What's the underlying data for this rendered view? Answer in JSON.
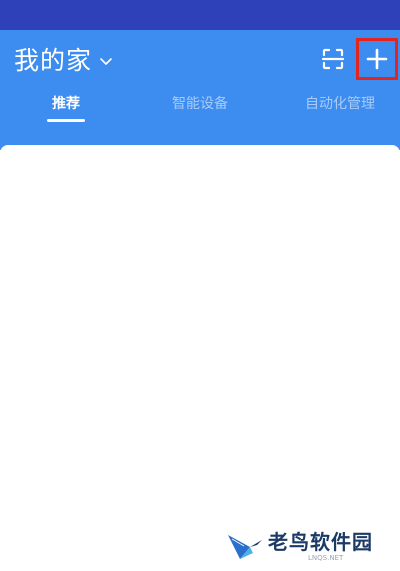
{
  "header": {
    "home_title": "我的家",
    "chevron_icon": "chevron-down-icon",
    "scan_icon": "scan-icon",
    "add_icon": "plus-icon",
    "background_color": "#3d8cf0",
    "highlight_color": "#e3241f"
  },
  "tabs": [
    {
      "label": "推荐",
      "active": true
    },
    {
      "label": "智能设备",
      "active": false
    },
    {
      "label": "自动化管理",
      "active": false
    }
  ],
  "status_bar": {
    "color": "#2f41b8"
  },
  "watermark": {
    "name": "老鸟软件园",
    "url": "LNQS.NET"
  }
}
